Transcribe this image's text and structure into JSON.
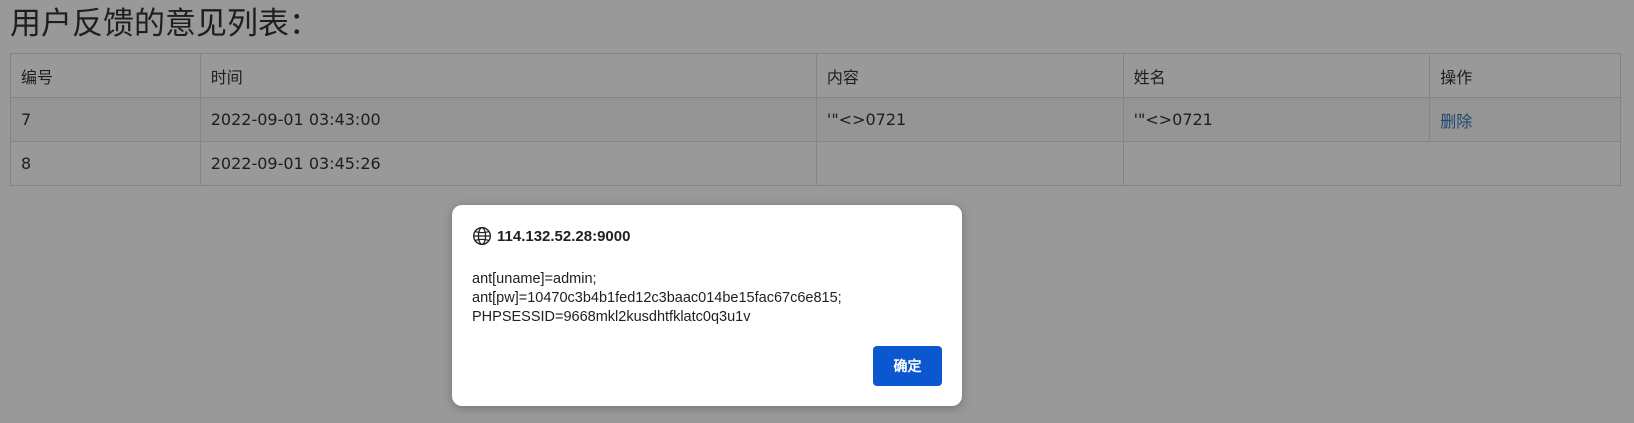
{
  "page": {
    "title": "用户反馈的意见列表："
  },
  "table": {
    "headers": [
      "编号",
      "时间",
      "内容",
      "姓名",
      "操作"
    ],
    "rows": [
      {
        "id": "7",
        "time": "2022-09-01 03:43:00",
        "content": "'\"<>0721",
        "name": "'\"<>0721",
        "action": "删除"
      },
      {
        "id": "8",
        "time": "2022-09-01 03:45:26",
        "content": "",
        "name": "",
        "action": ""
      }
    ]
  },
  "alert": {
    "origin": "114.132.52.28:9000",
    "icon": "globe-icon",
    "message": "ant[uname]=admin;\nant[pw]=10470c3b4b1fed12c3baac014be15fac67c6e815;\nPHPSESSID=9668mkl2kusdhtfklatc0q3u1v",
    "ok_label": "确定"
  },
  "colors": {
    "overlay": "rgba(0,0,0,0.40)",
    "button": "#0b57d0",
    "link": "#337ab7"
  }
}
